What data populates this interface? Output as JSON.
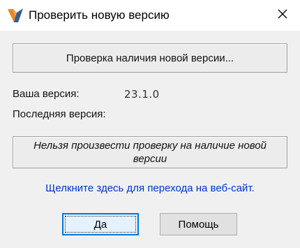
{
  "window": {
    "title": "Проверить новую версию",
    "icons": {
      "app": "app-logo-icon",
      "close": "close-icon"
    }
  },
  "status": {
    "text": "Проверка наличия новой версии..."
  },
  "versions": {
    "your_label": "Ваша версия:",
    "your_value": "23.1.0",
    "latest_label": "Последняя версия:"
  },
  "message": {
    "text": "Нельзя произвести проверку на наличие новой версии"
  },
  "link": {
    "text": "Щелкните здесь для перехода на веб-сайт.",
    "color": "#0033cc"
  },
  "buttons": {
    "ok_label": "Да",
    "help_label": "Помощь"
  },
  "colors": {
    "accent": "#0078d7",
    "background": "#f0f0f0"
  }
}
